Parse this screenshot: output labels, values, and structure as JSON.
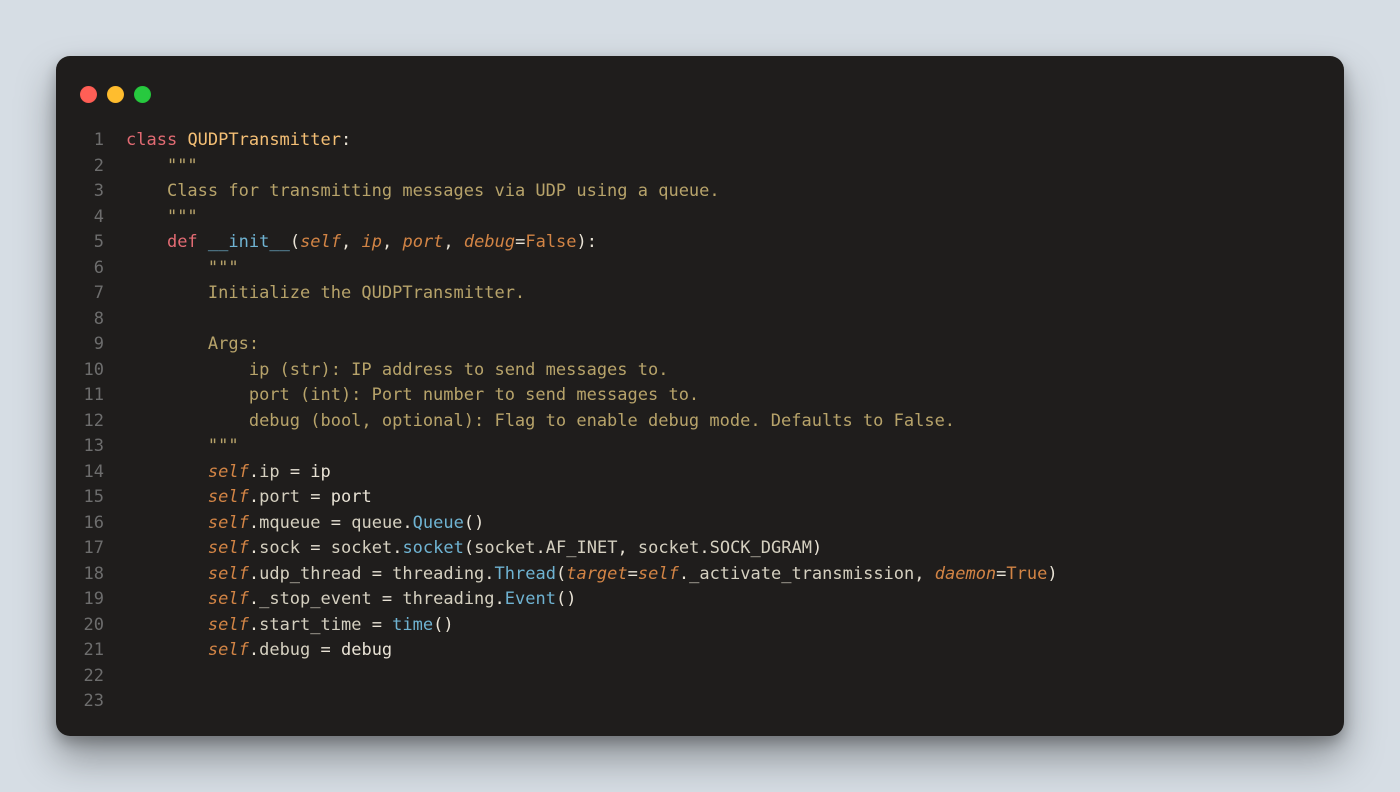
{
  "theme": {
    "bg_page": "#d6dde4",
    "bg_window": "#1f1d1c",
    "fg_default": "#e8e2d5",
    "fg_gutter": "#6d6d6d",
    "kw": "#e26b73",
    "cls": "#f4bf75",
    "fn": "#6fb3d2",
    "self": "#d28445",
    "str": "#b7a36a",
    "const": "#d28445"
  },
  "traffic_lights": [
    "close",
    "minimize",
    "zoom"
  ],
  "line_count": 23,
  "code_lines": [
    [
      [
        "kw",
        "class"
      ],
      [
        "pun",
        " "
      ],
      [
        "cls",
        "QUDPTransmitter"
      ],
      [
        "pun",
        ":"
      ]
    ],
    [
      [
        "pun",
        "    "
      ],
      [
        "str",
        "\"\"\""
      ]
    ],
    [
      [
        "pun",
        "    "
      ],
      [
        "str",
        "Class for transmitting messages via UDP using a queue."
      ]
    ],
    [
      [
        "pun",
        "    "
      ],
      [
        "str",
        "\"\"\""
      ]
    ],
    [
      [
        "pun",
        "    "
      ],
      [
        "kw",
        "def"
      ],
      [
        "pun",
        " "
      ],
      [
        "fn",
        "__init__"
      ],
      [
        "pun",
        "("
      ],
      [
        "self",
        "self"
      ],
      [
        "pun",
        ", "
      ],
      [
        "param",
        "ip"
      ],
      [
        "pun",
        ", "
      ],
      [
        "param",
        "port"
      ],
      [
        "pun",
        ", "
      ],
      [
        "param",
        "debug"
      ],
      [
        "pun",
        "="
      ],
      [
        "const",
        "False"
      ],
      [
        "pun",
        "):"
      ]
    ],
    [
      [
        "pun",
        "        "
      ],
      [
        "str",
        "\"\"\""
      ]
    ],
    [
      [
        "pun",
        "        "
      ],
      [
        "str",
        "Initialize the QUDPTransmitter."
      ]
    ],
    [
      [
        "pun",
        ""
      ]
    ],
    [
      [
        "pun",
        "        "
      ],
      [
        "str",
        "Args:"
      ]
    ],
    [
      [
        "pun",
        "            "
      ],
      [
        "str",
        "ip (str): IP address to send messages to."
      ]
    ],
    [
      [
        "pun",
        "            "
      ],
      [
        "str",
        "port (int): Port number to send messages to."
      ]
    ],
    [
      [
        "pun",
        "            "
      ],
      [
        "str",
        "debug (bool, optional): Flag to enable debug mode. Defaults to False."
      ]
    ],
    [
      [
        "pun",
        "        "
      ],
      [
        "str",
        "\"\"\""
      ]
    ],
    [
      [
        "pun",
        "        "
      ],
      [
        "self",
        "self"
      ],
      [
        "pun",
        "."
      ],
      [
        "attr",
        "ip"
      ],
      [
        "pun",
        " = ip"
      ]
    ],
    [
      [
        "pun",
        "        "
      ],
      [
        "self",
        "self"
      ],
      [
        "pun",
        "."
      ],
      [
        "attr",
        "port"
      ],
      [
        "pun",
        " = port"
      ]
    ],
    [
      [
        "pun",
        "        "
      ],
      [
        "self",
        "self"
      ],
      [
        "pun",
        "."
      ],
      [
        "attr",
        "mqueue"
      ],
      [
        "pun",
        " = "
      ],
      [
        "mod",
        "queue"
      ],
      [
        "pun",
        "."
      ],
      [
        "fn",
        "Queue"
      ],
      [
        "pun",
        "()"
      ]
    ],
    [
      [
        "pun",
        "        "
      ],
      [
        "self",
        "self"
      ],
      [
        "pun",
        "."
      ],
      [
        "attr",
        "sock"
      ],
      [
        "pun",
        " = "
      ],
      [
        "mod",
        "socket"
      ],
      [
        "pun",
        "."
      ],
      [
        "fn",
        "socket"
      ],
      [
        "pun",
        "("
      ],
      [
        "mod",
        "socket"
      ],
      [
        "pun",
        "."
      ],
      [
        "attr",
        "AF_INET"
      ],
      [
        "pun",
        ", "
      ],
      [
        "mod",
        "socket"
      ],
      [
        "pun",
        "."
      ],
      [
        "attr",
        "SOCK_DGRAM"
      ],
      [
        "pun",
        ")"
      ]
    ],
    [
      [
        "pun",
        "        "
      ],
      [
        "self",
        "self"
      ],
      [
        "pun",
        "."
      ],
      [
        "attr",
        "udp_thread"
      ],
      [
        "pun",
        " = "
      ],
      [
        "mod",
        "threading"
      ],
      [
        "pun",
        "."
      ],
      [
        "fn",
        "Thread"
      ],
      [
        "pun",
        "("
      ],
      [
        "param",
        "target"
      ],
      [
        "pun",
        "="
      ],
      [
        "self",
        "self"
      ],
      [
        "pun",
        "."
      ],
      [
        "attr",
        "_activate_transmission"
      ],
      [
        "pun",
        ", "
      ],
      [
        "param",
        "daemon"
      ],
      [
        "pun",
        "="
      ],
      [
        "const",
        "True"
      ],
      [
        "pun",
        ")"
      ]
    ],
    [
      [
        "pun",
        "        "
      ],
      [
        "self",
        "self"
      ],
      [
        "pun",
        "."
      ],
      [
        "attr",
        "_stop_event"
      ],
      [
        "pun",
        " = "
      ],
      [
        "mod",
        "threading"
      ],
      [
        "pun",
        "."
      ],
      [
        "fn",
        "Event"
      ],
      [
        "pun",
        "()"
      ]
    ],
    [
      [
        "pun",
        "        "
      ],
      [
        "self",
        "self"
      ],
      [
        "pun",
        "."
      ],
      [
        "attr",
        "start_time"
      ],
      [
        "pun",
        " = "
      ],
      [
        "fn",
        "time"
      ],
      [
        "pun",
        "()"
      ]
    ],
    [
      [
        "pun",
        "        "
      ],
      [
        "self",
        "self"
      ],
      [
        "pun",
        "."
      ],
      [
        "attr",
        "debug"
      ],
      [
        "pun",
        " = debug"
      ]
    ],
    [
      [
        "pun",
        ""
      ]
    ],
    [
      [
        "pun",
        ""
      ]
    ]
  ]
}
